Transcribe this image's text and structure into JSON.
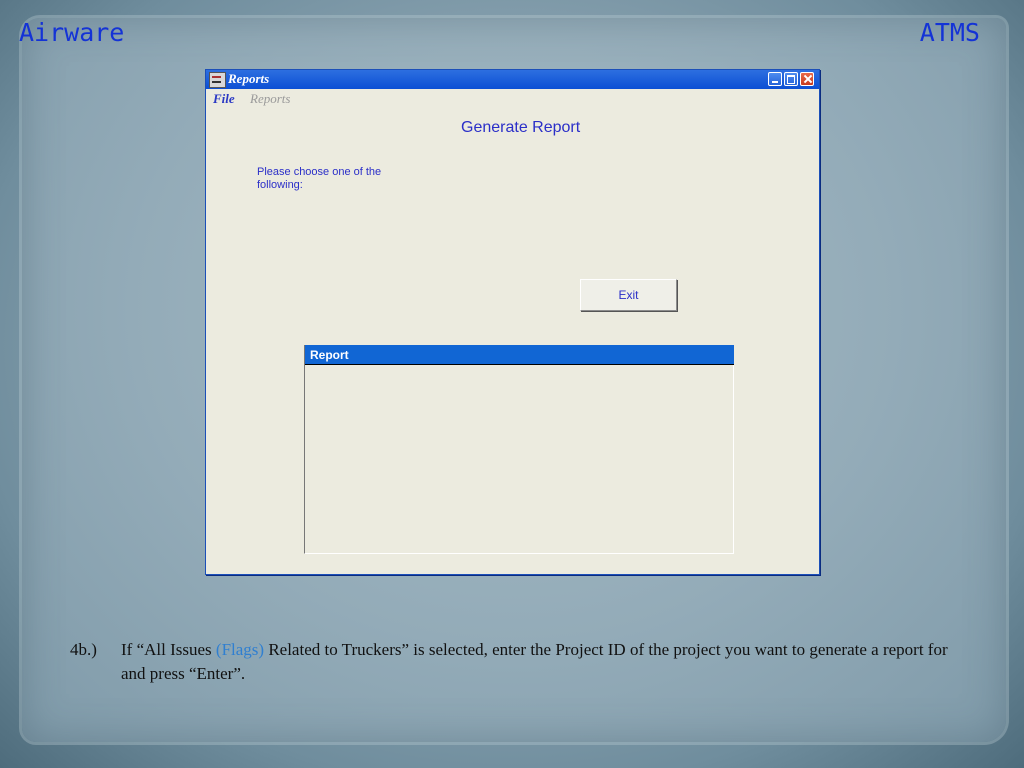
{
  "slide": {
    "corner_left": "Airware",
    "corner_right": "ATMS"
  },
  "window": {
    "title": "Reports",
    "menu": {
      "file": "File",
      "reports": "Reports"
    },
    "heading": "Generate Report",
    "prompt": "Please choose one of the following:",
    "exit_label": "Exit",
    "report_panel": {
      "header": "Report"
    }
  },
  "caption": {
    "number": "4b.)",
    "before": "If “All Issues ",
    "flags": "(Flags)",
    "after": " Related to Truckers” is selected, enter the Project ID of the project you want to generate a report for and press “Enter”."
  },
  "colors": {
    "accent_blue": "#2b2fc8",
    "titlebar_blue": "#0b4fd4",
    "flags_blue": "#2f7fd1"
  },
  "icons": [
    "app-icon",
    "minimize-icon",
    "maximize-icon",
    "close-icon"
  ]
}
